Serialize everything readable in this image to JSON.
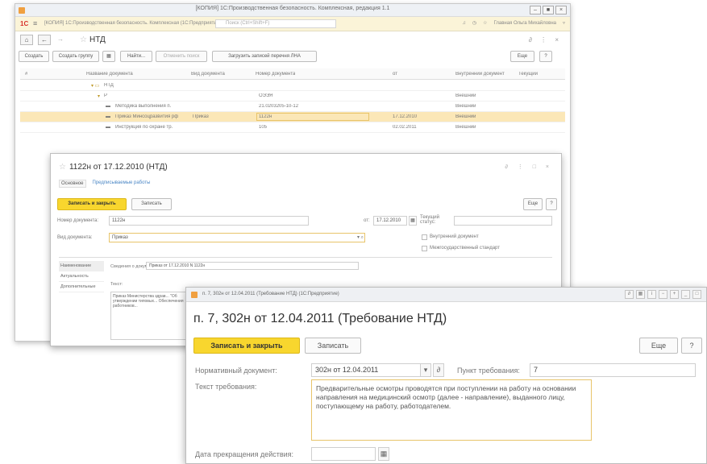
{
  "window1": {
    "title": "[КОПИЯ] 1С:Производственная безопасность. Комплексная, редакция 1.1",
    "window_buttons": [
      "–",
      "■",
      "×"
    ],
    "section_bar": {
      "logo": "1С",
      "section_title": "[КОПИЯ] 1С:Производственная безопасность. Комплексная (1С:Предприятие)",
      "search_placeholder": "Поиск (Ctrl+Shift+F)",
      "user": "Главная Ольга Михайловна"
    },
    "nav": {
      "title": "НТД",
      "right": "∂ ⋮ ×"
    },
    "commands": {
      "create": "Создать",
      "create_group": "Создать группу",
      "find": "Найти...",
      "cancel_search": "Отменить поиск",
      "load_ntd": "Загрузить записей перечня ЛНА",
      "more": "Еще",
      "help": "?"
    },
    "table": {
      "columns": [
        "#",
        "Название документа",
        "Вид документа",
        "Номер документа",
        "",
        "от",
        "Внутренний документ",
        "Текущий"
      ],
      "rows": [
        {
          "name": "НТД",
          "kind": "",
          "number": "",
          "date": "",
          "internal": "",
          "selected": false,
          "level": 0
        },
        {
          "name": "Р",
          "kind": "",
          "number": "ОЭЭЯ",
          "date": "",
          "internal": "Внешний",
          "selected": false,
          "level": 1
        },
        {
          "name": "Методика выполнения п.",
          "kind": "",
          "number": "21.0203205-10-12",
          "date": "",
          "internal": "Внешний",
          "selected": false,
          "level": 2
        },
        {
          "name": "Приказ Минсоцразвития рф",
          "kind": "Приказ",
          "number": "1122н",
          "date": "17.12.2010",
          "internal": "Внешний",
          "selected": true,
          "level": 2
        },
        {
          "name": "Инструкция по охране тр.",
          "kind": "",
          "number": "105",
          "date": "02.02.2011",
          "internal": "Внешний",
          "selected": false,
          "level": 2
        }
      ]
    }
  },
  "window2": {
    "title": "1122н от 17.12.2010 (НТД)",
    "right": "∂ ⋮ □ ×",
    "tabs": {
      "main": "Основное",
      "link": "Предписываемые работы"
    },
    "save_close": "Записать и закрыть",
    "save": "Записать",
    "more": "Еще",
    "help": "?",
    "number_label": "Номер документа:",
    "number_value": "1122н",
    "date_label": "от:",
    "date_value": "17.12.2010",
    "status_label": "Текущий статус:",
    "kind_label": "Вид документа:",
    "kind_value": "Приказ",
    "internal_doc": "Внутренний документ",
    "interstate": "Межгосударственный стандарт",
    "left_nav": [
      "Наименование",
      "Актуальность",
      "Дополнительные"
    ],
    "info_label": "Сведения о документе:",
    "info_value": "Приказ от 17.12.2010 N 1122н",
    "text_label": "Текст:",
    "memo": "Приказ Министерства здрав... \"Об утверждении типовых... Обеспечения работников..."
  },
  "window3": {
    "titlebar": "п. 7, 302н от 12.04.2011 (Требование НТД) (1С:Предприятие)",
    "title": "п. 7, 302н от 12.04.2011 (Требование НТД)",
    "save_close": "Записать и закрыть",
    "save": "Записать",
    "more": "Еще",
    "help": "?",
    "normdoc_label": "Нормативный документ:",
    "normdoc_value": "302н от 12.04.2011",
    "clause_label": "Пункт требования:",
    "clause_value": "7",
    "text_label": "Текст требования:",
    "text_value": "Предварительные осмотры проводятся при поступлении на работу на основании направления на медицинский осмотр (далее - направление), выданного лицу, поступающему на работу, работодателем.",
    "end_label": "Дата прекращения действия:",
    "end_value": ""
  }
}
